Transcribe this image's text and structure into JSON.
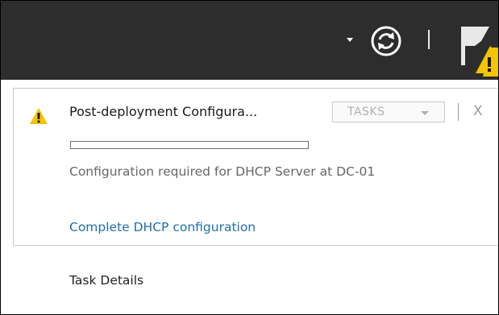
{
  "toolbar": {
    "dropdown_icon": "chevron-down-icon",
    "refresh_icon": "refresh-icon",
    "flag_icon": "notifications-flag-warning-icon",
    "background_color": "#2d2d2d"
  },
  "notification": {
    "status_icon": "warning-icon",
    "title": "Post-deployment Configura...",
    "tasks_label": "TASKS",
    "close_label": "X",
    "progress_fraction": 0,
    "description": "Configuration required for DHCP Server at DC-01",
    "action_link": "Complete DHCP configuration",
    "link_color": "#1f6fa8",
    "warning_color": "#f5c400"
  },
  "footer": {
    "task_details_label": "Task Details"
  }
}
